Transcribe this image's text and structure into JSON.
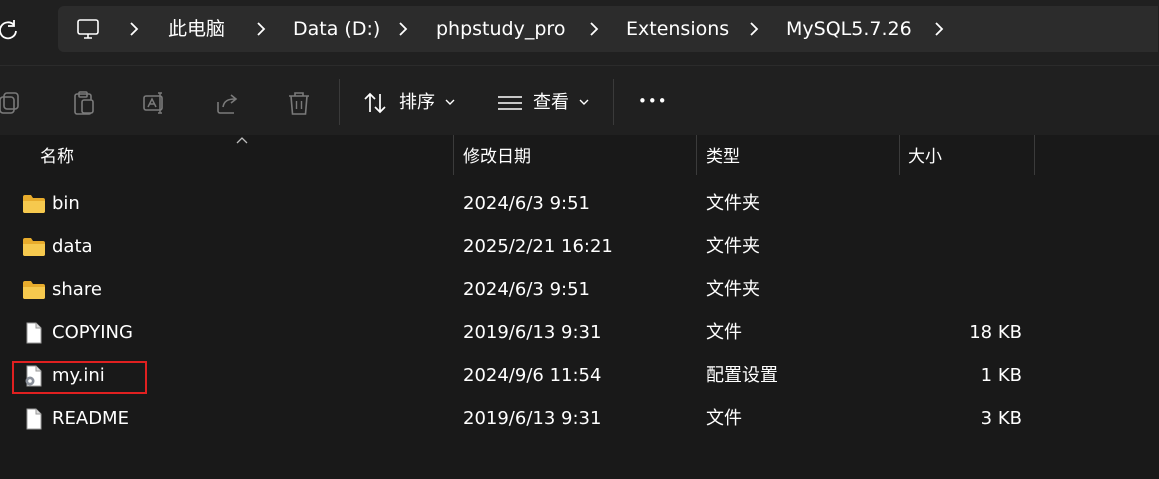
{
  "breadcrumb": {
    "items": [
      "此电脑",
      "Data (D:)",
      "phpstudy_pro",
      "Extensions",
      "MySQL5.7.26"
    ]
  },
  "toolbar": {
    "sort_label": "排序",
    "view_label": "查看",
    "more_label": "•••"
  },
  "columns": {
    "name": "名称",
    "date": "修改日期",
    "type": "类型",
    "size": "大小"
  },
  "files": [
    {
      "name": "bin",
      "date": "2024/6/3 9:51",
      "type": "文件夹",
      "size": "",
      "icon": "folder-icon"
    },
    {
      "name": "data",
      "date": "2025/2/21 16:21",
      "type": "文件夹",
      "size": "",
      "icon": "folder-icon"
    },
    {
      "name": "share",
      "date": "2024/6/3 9:51",
      "type": "文件夹",
      "size": "",
      "icon": "folder-icon"
    },
    {
      "name": "COPYING",
      "date": "2019/6/13 9:31",
      "type": "文件",
      "size": "18 KB",
      "icon": "file-icon"
    },
    {
      "name": "my.ini",
      "date": "2024/9/6 11:54",
      "type": "配置设置",
      "size": "1 KB",
      "icon": "config-file-icon"
    },
    {
      "name": "README",
      "date": "2019/6/13 9:31",
      "type": "文件",
      "size": "3 KB",
      "icon": "file-icon"
    }
  ],
  "colors": {
    "background": "#191919",
    "chrome": "#202020",
    "address_box": "#2c2c2c",
    "folder": "#f2c04a",
    "highlight": "#e02020"
  }
}
